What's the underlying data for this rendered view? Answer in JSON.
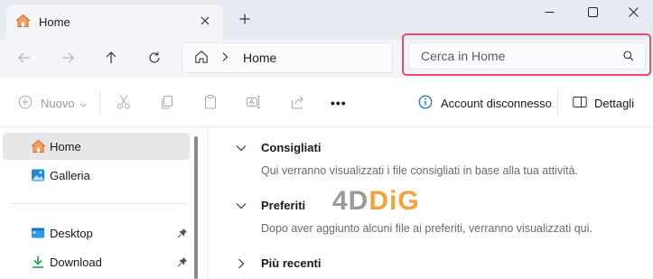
{
  "tab": {
    "title": "Home",
    "close_icon": "close-icon",
    "new_tab_icon": "plus-icon"
  },
  "window_controls": [
    "minimize-icon",
    "maximize-icon",
    "close-icon"
  ],
  "address": {
    "crumb": "Home",
    "search_placeholder": "Cerca in Home"
  },
  "toolbar": {
    "new_label": "Nuovo",
    "account_label": "Account disconnesso",
    "details_label": "Dettagli",
    "more_label": "•••"
  },
  "sidebar": {
    "items": [
      {
        "label": "Home",
        "icon": "home-icon",
        "active": true
      },
      {
        "label": "Galleria",
        "icon": "gallery-icon"
      },
      {
        "label": "Desktop",
        "icon": "desktop-icon",
        "pinned": true
      },
      {
        "label": "Download",
        "icon": "download-icon",
        "pinned": true
      }
    ]
  },
  "main": {
    "sections": [
      {
        "title": "Consigliati",
        "expanded": true,
        "desc": "Qui verranno visualizzati i file consigliati in base alla tua attività."
      },
      {
        "title": "Preferiti",
        "expanded": true,
        "desc": "Dopo aver aggiunto alcuni file ai preferiti, verranno visualizzati qui."
      },
      {
        "title": "Più recenti",
        "expanded": false
      }
    ]
  },
  "watermark": {
    "part1": "4D",
    "part2": "DiG"
  },
  "colors": {
    "highlight": "#e94b6e",
    "home_icon": "#e6772e",
    "accent": "#0067c0"
  }
}
